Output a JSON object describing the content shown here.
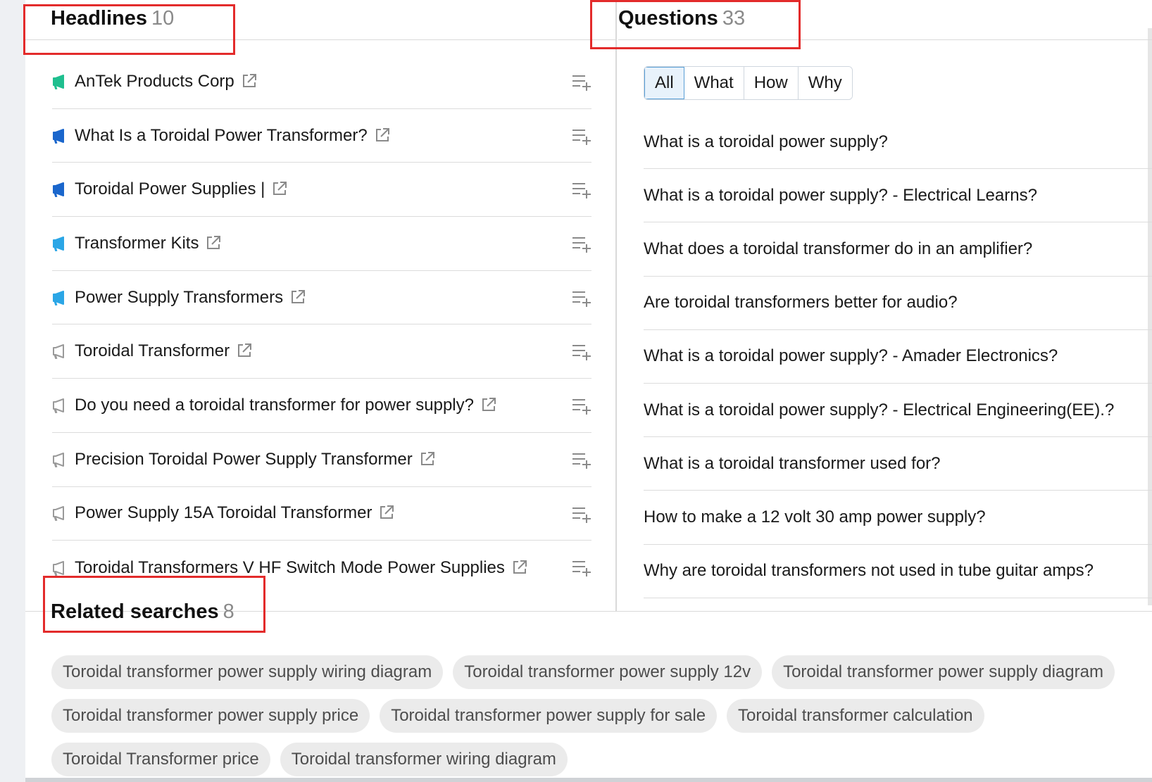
{
  "headlines": {
    "title": "Headlines",
    "count": "10",
    "items": [
      {
        "label": "AnTek Products Corp",
        "icon_color": "#1fbf8f"
      },
      {
        "label": "What Is a Toroidal Power Transformer?",
        "icon_color": "#1a66cc"
      },
      {
        "label": "Toroidal Power Supplies |",
        "icon_color": "#1a66cc"
      },
      {
        "label": "Transformer Kits",
        "icon_color": "#2ba6e6"
      },
      {
        "label": "Power Supply Transformers",
        "icon_color": "#2ba6e6"
      },
      {
        "label": "Toroidal Transformer",
        "icon_color": "#9a9a9a"
      },
      {
        "label": "Do you need a toroidal transformer for power supply?",
        "icon_color": "#9a9a9a"
      },
      {
        "label": "Precision Toroidal Power Supply Transformer",
        "icon_color": "#9a9a9a"
      },
      {
        "label": "Power Supply 15A Toroidal Transformer",
        "icon_color": "#9a9a9a"
      },
      {
        "label": "Toroidal Transformers V HF Switch Mode Power Supplies",
        "icon_color": "#9a9a9a"
      }
    ]
  },
  "questions": {
    "title": "Questions",
    "count": "33",
    "filters": [
      "All",
      "What",
      "How",
      "Why"
    ],
    "active_filter": "All",
    "items": [
      "What is a toroidal power supply?",
      "What is a toroidal power supply? - Electrical Learns?",
      "What does a toroidal transformer do in an amplifier?",
      "Are toroidal transformers better for audio?",
      "What is a toroidal power supply? - Amader Electronics?",
      "What is a toroidal power supply? - Electrical Engineering(EE).?",
      "What is a toroidal transformer used for?",
      "How to make a 12 volt 30 amp power supply?",
      "Why are toroidal transformers not used in tube guitar amps?"
    ]
  },
  "related": {
    "title": "Related searches",
    "count": "8",
    "chips": [
      "Toroidal transformer power supply wiring diagram",
      "Toroidal transformer power supply 12v",
      "Toroidal transformer power supply diagram",
      "Toroidal transformer power supply price",
      "Toroidal transformer power supply for sale",
      "Toroidal transformer calculation",
      "Toroidal Transformer price",
      "Toroidal transformer wiring diagram"
    ]
  },
  "colors": {
    "highlight_box": "#e32b2b",
    "active_filter_bg": "#e8f2fb"
  }
}
